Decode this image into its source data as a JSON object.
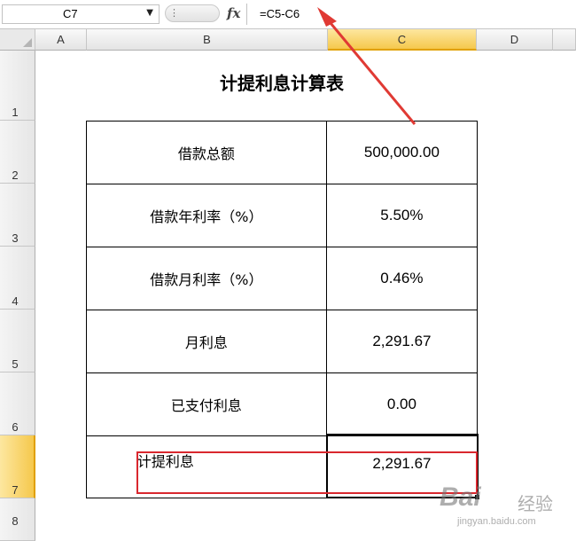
{
  "formula_bar": {
    "name_box": "C7",
    "fx_label": "fx",
    "formula": "=C5-C6"
  },
  "columns": [
    "A",
    "B",
    "C",
    "D"
  ],
  "rows": [
    "1",
    "2",
    "3",
    "4",
    "5",
    "6",
    "7",
    "8"
  ],
  "selected": {
    "column": "C",
    "row": "7"
  },
  "sheet": {
    "title": "计提利息计算表",
    "items": [
      {
        "label": "借款总额",
        "value": "500,000.00"
      },
      {
        "label": "借款年利率（%）",
        "value": "5.50%"
      },
      {
        "label": "借款月利率（%）",
        "value": "0.46%"
      },
      {
        "label": "月利息",
        "value": "2,291.67"
      },
      {
        "label": "已支付利息",
        "value": "0.00"
      },
      {
        "label": "计提利息",
        "value": "2,291.67"
      }
    ]
  },
  "annotation": {
    "highlight_color": "#d9272e"
  },
  "watermark": {
    "logo": "Bai",
    "text": "经验",
    "url": "jingyan.baidu.com"
  }
}
